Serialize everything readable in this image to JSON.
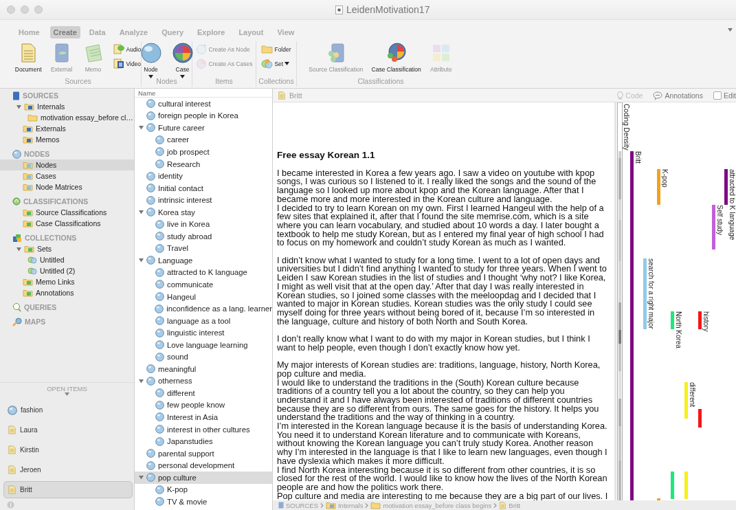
{
  "window": {
    "title": "LeidenMotivation17"
  },
  "ribbon": {
    "tabs": [
      {
        "label": "Home",
        "selected": false
      },
      {
        "label": "Create",
        "selected": true
      },
      {
        "label": "Data",
        "selected": false
      },
      {
        "label": "Analyze",
        "selected": false
      },
      {
        "label": "Query",
        "selected": false
      },
      {
        "label": "Explore",
        "selected": false
      },
      {
        "label": "Layout",
        "selected": false
      },
      {
        "label": "View",
        "selected": false
      }
    ],
    "groups": [
      {
        "label": "Sources",
        "tools": [
          {
            "label": "Document",
            "kind": "large",
            "disabled": false,
            "dropdown": false
          },
          {
            "label": "External",
            "kind": "large",
            "disabled": true,
            "dropdown": false
          },
          {
            "label": "Memo",
            "kind": "large",
            "disabled": true,
            "dropdown": false
          },
          {
            "label": "Audio",
            "kind": "small",
            "disabled": false,
            "dropdown": false
          },
          {
            "label": "Video",
            "kind": "small",
            "disabled": false,
            "dropdown": false
          }
        ]
      },
      {
        "label": "Nodes",
        "tools": [
          {
            "label": "Node",
            "kind": "large",
            "disabled": false,
            "dropdown": true
          },
          {
            "label": "Case",
            "kind": "large",
            "disabled": false,
            "dropdown": true
          }
        ]
      },
      {
        "label": "Items",
        "tools": [
          {
            "label": "Create As Node",
            "kind": "small",
            "disabled": true,
            "dropdown": false
          },
          {
            "label": "Create As Cases",
            "kind": "small",
            "disabled": true,
            "dropdown": false
          }
        ]
      },
      {
        "label": "Collections",
        "tools": [
          {
            "label": "Folder",
            "kind": "small",
            "disabled": false,
            "dropdown": false
          },
          {
            "label": "Set",
            "kind": "small",
            "disabled": false,
            "dropdown": true
          }
        ]
      },
      {
        "label": "Classifications",
        "tools": [
          {
            "label": "Source Classification",
            "kind": "large",
            "disabled": true,
            "dropdown": false
          },
          {
            "label": "Case Classification",
            "kind": "large",
            "disabled": false,
            "dropdown": false
          },
          {
            "label": "Attribute",
            "kind": "large",
            "disabled": true,
            "dropdown": false
          }
        ]
      }
    ]
  },
  "sidebar": {
    "sections": [
      {
        "label": "SOURCES",
        "items": [
          {
            "label": "Internals",
            "selected": false,
            "expanded": true,
            "children": [
              {
                "label": "motivation essay_before cl…",
                "selected": false
              }
            ]
          },
          {
            "label": "Externals",
            "selected": false
          },
          {
            "label": "Memos",
            "selected": false
          }
        ]
      },
      {
        "label": "NODES",
        "items": [
          {
            "label": "Nodes",
            "selected": true
          },
          {
            "label": "Cases",
            "selected": false
          },
          {
            "label": "Node Matrices",
            "selected": false
          }
        ]
      },
      {
        "label": "CLASSIFICATIONS",
        "items": [
          {
            "label": "Source Classifications",
            "selected": false
          },
          {
            "label": "Case Classifications",
            "selected": false
          }
        ]
      },
      {
        "label": "COLLECTIONS",
        "items": [
          {
            "label": "Sets",
            "selected": false,
            "expanded": true,
            "children": [
              {
                "label": "Untitled",
                "selected": false
              },
              {
                "label": "Untitled (2)",
                "selected": false
              }
            ]
          },
          {
            "label": "Memo Links",
            "selected": false
          },
          {
            "label": "Annotations",
            "selected": false
          }
        ]
      },
      {
        "label": "QUERIES"
      },
      {
        "label": "MAPS"
      }
    ],
    "open_items": {
      "label": "OPEN ITEMS",
      "items": [
        {
          "label": "fashion",
          "kind": "node",
          "selected": false
        },
        {
          "label": "Laura",
          "kind": "document",
          "selected": false
        },
        {
          "label": "Kirstin",
          "kind": "document",
          "selected": false
        },
        {
          "label": "Jeroen",
          "kind": "document",
          "selected": false
        },
        {
          "label": "Britt",
          "kind": "document",
          "selected": true
        }
      ]
    }
  },
  "node_list": {
    "column": "Name",
    "nodes": [
      {
        "label": "cultural interest",
        "selected": false
      },
      {
        "label": "foreign people in Korea",
        "selected": false
      },
      {
        "label": "Future career",
        "selected": false,
        "expanded": true,
        "children": [
          {
            "label": "career",
            "selected": false
          },
          {
            "label": "job prospect",
            "selected": false
          },
          {
            "label": "Research",
            "selected": false
          }
        ]
      },
      {
        "label": "identity",
        "selected": false
      },
      {
        "label": "Initial contact",
        "selected": false
      },
      {
        "label": "intrinsic interest",
        "selected": false
      },
      {
        "label": "Korea stay",
        "selected": false,
        "expanded": true,
        "children": [
          {
            "label": "live in Korea",
            "selected": false
          },
          {
            "label": "study abroad",
            "selected": false
          },
          {
            "label": "Travel",
            "selected": false
          }
        ]
      },
      {
        "label": "Language",
        "selected": false,
        "expanded": true,
        "children": [
          {
            "label": "attracted to K language",
            "selected": false
          },
          {
            "label": "communicate",
            "selected": false
          },
          {
            "label": "Hangeul",
            "selected": false
          },
          {
            "label": "inconfidence as a lang. learner",
            "selected": false
          },
          {
            "label": "language as a tool",
            "selected": false
          },
          {
            "label": "linguistic interest",
            "selected": false
          },
          {
            "label": "Love language learning",
            "selected": false
          },
          {
            "label": "sound",
            "selected": false
          }
        ]
      },
      {
        "label": "meaningful",
        "selected": false
      },
      {
        "label": "otherness",
        "selected": false,
        "expanded": true,
        "children": [
          {
            "label": "different",
            "selected": false
          },
          {
            "label": "few people know",
            "selected": false
          },
          {
            "label": "Interest in Asia",
            "selected": false
          },
          {
            "label": "interest in other cultures",
            "selected": false
          },
          {
            "label": "Japanstudies",
            "selected": false
          }
        ]
      },
      {
        "label": "parental support",
        "selected": false
      },
      {
        "label": "personal development",
        "selected": false
      },
      {
        "label": "pop culture",
        "selected": true,
        "expanded": true,
        "children": [
          {
            "label": "K-pop",
            "selected": false
          },
          {
            "label": "TV & movie",
            "selected": false
          }
        ]
      }
    ]
  },
  "document": {
    "title": "Britt",
    "toolbar": [
      {
        "label": "Code",
        "disabled": true
      },
      {
        "label": "Annotations",
        "disabled": false
      }
    ],
    "edit": {
      "label": "Edit",
      "checked": false
    },
    "heading": "Free essay Korean 1.1",
    "blocks": [
      {
        "paragraphs": [
          "I became interested in Korea a few years ago. I saw a video on youtube with kpop songs, I was curious so I listened to it. I really liked the songs and the sound of the language so I looked up more about kpop and the Korean language. After that I became more and more interested in the Korean culture and language.",
          "I decided to try to learn Korean on my own. First I learned Hangeul with the help of a few sites that explained it, after that I found the site memrise.com, which is a site where you can learn vocabulary, and studied about 10 words a day. I later bought a textbook to help me study Korean, but as I entered my final year of high school I had to focus on my homework and couldn’t study Korean as much as I wanted."
        ]
      },
      {
        "paragraphs": [
          "I didn’t know what I wanted to study for a long time. I went to a lot of open days and universities but I didn’t find anything I wanted to study for three years. When I went to Leiden I saw Korean studies in the list of studies and I thought ‘why not? I like Korea, I might as well visit that at the open day.’ After that day I was really interested in Korean studies, so I joined some classes with the meeloopdag and I decided that I wanted to major in Korean studies. Korean studies was the only study I could see myself doing for three years without being bored of it, because I’m so interested in the language, culture and history of both North and South Korea."
        ]
      },
      {
        "paragraphs": [
          "I don’t really know what I want to do with my major in Korean studies, but I think I want to help people, even though I don’t exactly know how yet."
        ]
      },
      {
        "paragraphs": [
          "My major interests of Korean studies are: traditions, language, history, North Korea, pop culture and media.",
          "I would like to understand the traditions in the (South) Korean culture because traditions of a country tell you a lot about the country, so they can help you understand it and I have always been interested of traditions of different countries because they are so different from ours. The same goes for the history. It helps you understand the traditions and the way of thinking in a country.",
          "I’m interested in the Korean language because it is the basis of understanding Korea. You need it to understand Korean literature and to communicate with Koreans, without knowing the Korean language you can’t truly study Korea. Another reason why I’m interested in the language is that I like to learn new languages, even though I have dyslexia which makes it more difficult.",
          "I find North Korea interesting because it is so different from other countries, it is so closed for the rest of the world. I would like to know how the lives of the North Korean people are and how the politics work there.",
          "Pop culture and media are interesting to me because they are a big part of our lives. I"
        ]
      }
    ],
    "breadcrumb": [
      "SOURCES",
      "Internals",
      "motivation essay_before class begins",
      "Britt"
    ]
  },
  "coding_stripes": {
    "density_label": "Coding Density",
    "stripes": [
      {
        "label": "Britt",
        "color": "#7e0a84"
      },
      {
        "label": "K-pop",
        "color": "#f5a01e"
      },
      {
        "label": "attracted to K language",
        "color": "#7e0a84"
      },
      {
        "label": "Self study",
        "color": "#c061d8"
      },
      {
        "label": "search for a right major",
        "color": "#8fcbe8"
      },
      {
        "label": "North Korea",
        "color": "#1fe87a"
      },
      {
        "label": "history",
        "color": "#f51616"
      },
      {
        "label": "different",
        "color": "#f5f01a"
      },
      {
        "color": "#f51616"
      },
      {
        "color": "#1fe87a"
      },
      {
        "color": "#f5f01a"
      },
      {
        "color": "#f5a01e"
      }
    ]
  }
}
